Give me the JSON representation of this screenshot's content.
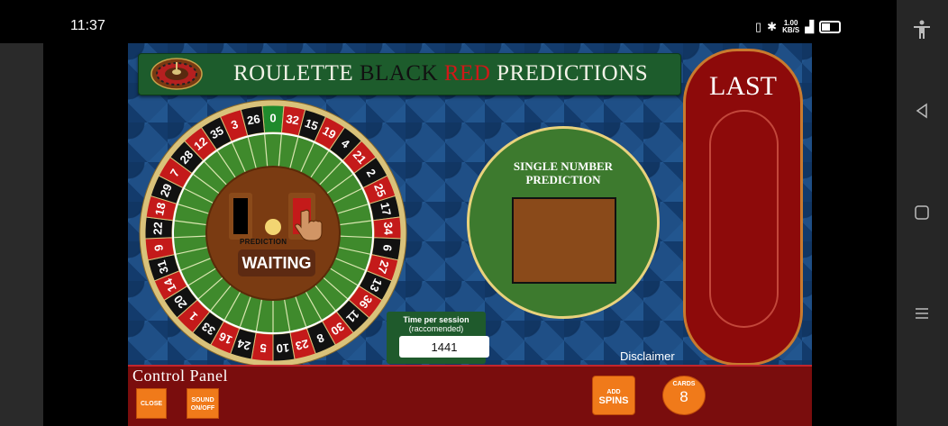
{
  "status_bar": {
    "time": "11:37",
    "net_speed_top": "1.00",
    "net_speed_bottom": "KB/S"
  },
  "title": {
    "part1": "ROULETTE ",
    "black_word": "BLACK",
    "red_word": "RED",
    "part2": " PREDICTIONS"
  },
  "wheel": {
    "numbers": [
      "0",
      "32",
      "15",
      "19",
      "4",
      "21",
      "2",
      "25",
      "17",
      "34",
      "6",
      "27",
      "13",
      "36",
      "11",
      "30",
      "8",
      "23",
      "10",
      "5",
      "24",
      "16",
      "33",
      "1",
      "20",
      "14",
      "31",
      "9",
      "22",
      "18",
      "29",
      "7",
      "28",
      "12",
      "35",
      "3",
      "26"
    ],
    "prediction_label": "PREDICTION",
    "status": "WAITING"
  },
  "single_number": {
    "title_line1": "SINGLE NUMBER",
    "title_line2": "PREDICTION"
  },
  "last_panel": {
    "title": "LAST"
  },
  "session": {
    "title": "Time per session",
    "subtitle": "(raccomended)",
    "value": "1441"
  },
  "disclaimer": "Disclaimer",
  "control_panel": {
    "title": "Control Panel",
    "close": "CLOSE",
    "sound_line1": "SOUND",
    "sound_line2": "ON/OFF",
    "add_spins_small": "ADD",
    "add_spins_big": "SPINS",
    "cards_label": "CARDS",
    "cards_value": "8"
  },
  "colors": {
    "felt_green": "#1d5c2c",
    "roulette_red": "#c41a1a",
    "accent_orange": "#f07a1a",
    "panel_maroon": "#7a0d0d"
  },
  "nav_icons": [
    "accessibility-icon",
    "back-icon",
    "home-icon",
    "menu-icon"
  ]
}
